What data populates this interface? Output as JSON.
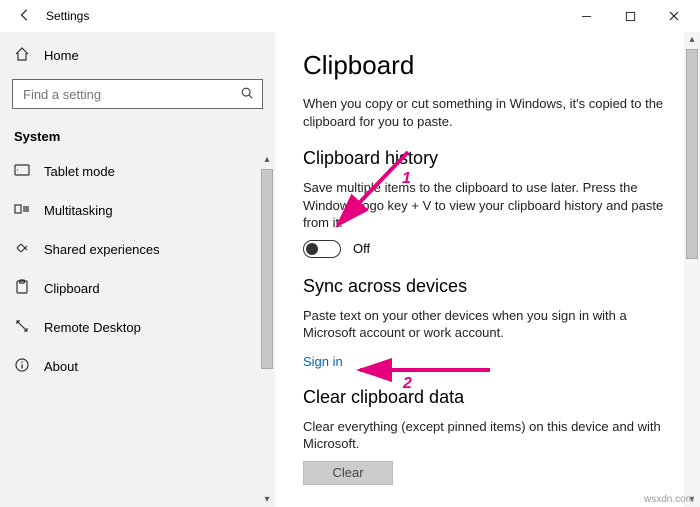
{
  "titlebar": {
    "title": "Settings"
  },
  "sidebar": {
    "home": "Home",
    "search_placeholder": "Find a setting",
    "section": "System",
    "items": [
      {
        "label": "Tablet mode"
      },
      {
        "label": "Multitasking"
      },
      {
        "label": "Shared experiences"
      },
      {
        "label": "Clipboard"
      },
      {
        "label": "Remote Desktop"
      },
      {
        "label": "About"
      }
    ]
  },
  "content": {
    "h1": "Clipboard",
    "intro": "When you copy or cut something in Windows, it's copied to the clipboard for you to paste.",
    "history_h": "Clipboard history",
    "history_p": "Save multiple items to the clipboard to use later. Press the Windows logo key + V to view your clipboard history and paste from it.",
    "toggle_state": "Off",
    "sync_h": "Sync across devices",
    "sync_p": "Paste text on your other devices when you sign in with a Microsoft account or work account.",
    "signin": "Sign in",
    "clear_h": "Clear clipboard data",
    "clear_p": "Clear everything (except pinned items) on this device and with Microsoft.",
    "clear_btn": "Clear"
  },
  "annotations": {
    "a1": "1",
    "a2": "2"
  },
  "watermark": "wsxdn.com"
}
